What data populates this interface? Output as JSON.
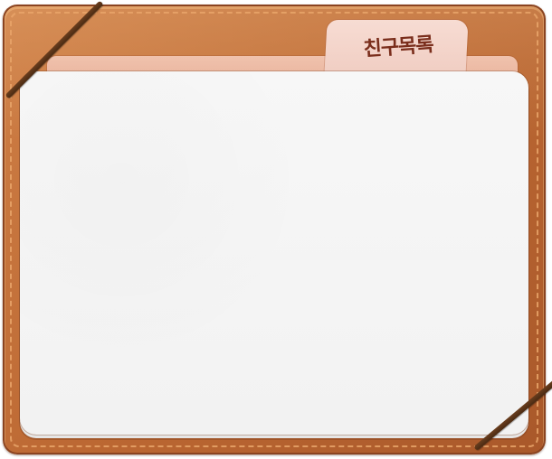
{
  "panel": {
    "tab_label": "친구목록"
  }
}
